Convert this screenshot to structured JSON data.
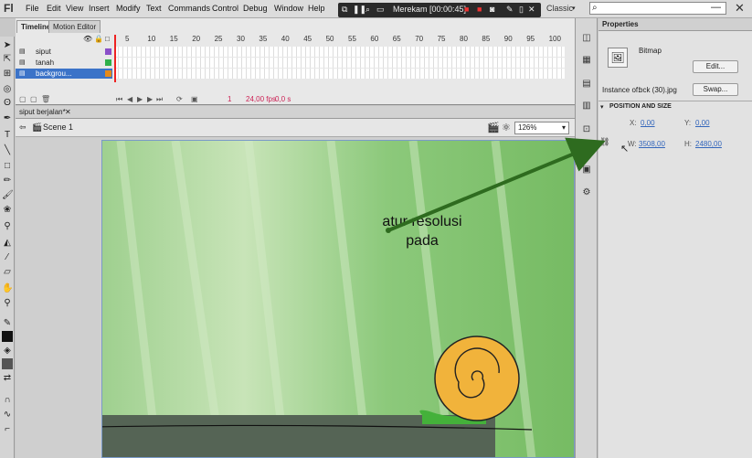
{
  "app": {
    "logo": "Fl"
  },
  "menu": [
    "File",
    "Edit",
    "View",
    "Insert",
    "Modify",
    "Text",
    "Commands",
    "Control",
    "Debug",
    "Window",
    "Help"
  ],
  "recorder": {
    "label": "Merekam [00:00:45]"
  },
  "workspace": "Classic",
  "search": {
    "placeholder": ""
  },
  "timeline": {
    "tabs": [
      "Timeline",
      "Motion Editor"
    ],
    "frame_numbers": [
      "5",
      "10",
      "15",
      "20",
      "25",
      "30",
      "35",
      "40",
      "45",
      "50",
      "55",
      "60",
      "65",
      "70",
      "75",
      "80",
      "85",
      "90",
      "95",
      "100"
    ],
    "layers": [
      "siput",
      "tanah",
      "backgrou..."
    ],
    "footer": {
      "frame": "1",
      "fps": "24,00 fps",
      "time": "0,0 s"
    }
  },
  "document": {
    "tab": "siput berjalan*",
    "scene": "Scene 1",
    "zoom": "126%"
  },
  "stage": {
    "annotation_line1": "atur resolusi",
    "annotation_line2": "pada"
  },
  "properties": {
    "tab": "Properties",
    "type": "Bitmap",
    "edit_label": "Edit...",
    "instance_label": "Instance of:",
    "instance_value": "bck (30).jpg",
    "swap_label": "Swap...",
    "section": "POSITION AND SIZE",
    "x_label": "X:",
    "x_value": "0,00",
    "y_label": "Y:",
    "y_value": "0,00",
    "w_label": "W:",
    "w_value": "3508,00",
    "h_label": "H:",
    "h_value": "2480,00"
  },
  "colors": {
    "accent_arrow": "#2e6b1f",
    "playhead": "#e22222"
  }
}
